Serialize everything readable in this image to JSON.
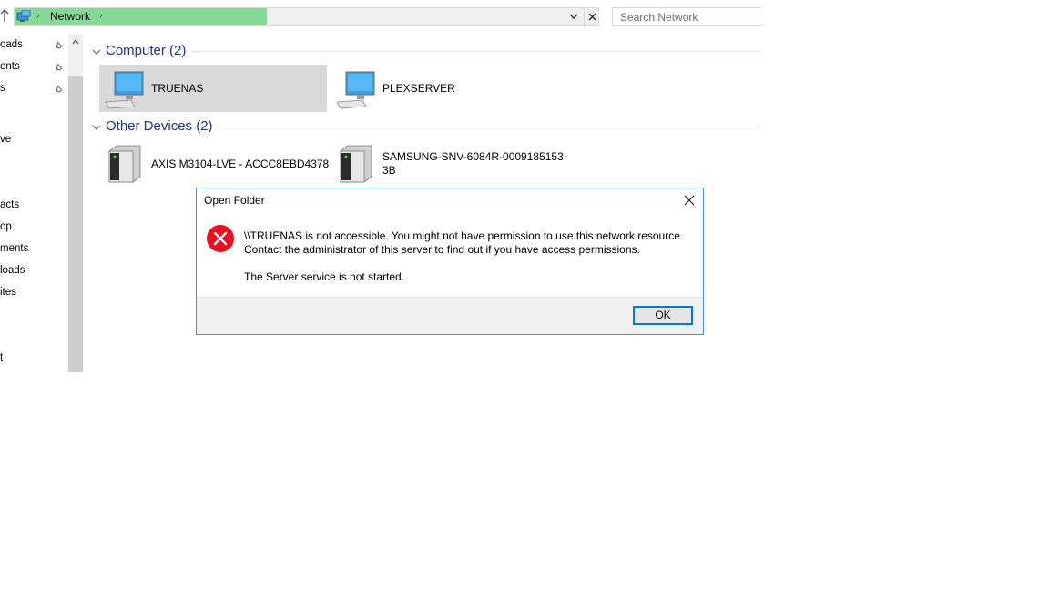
{
  "address": {
    "crumb": "Network",
    "sep": "›"
  },
  "search": {
    "placeholder": "Search Network"
  },
  "nav": {
    "items": [
      "oads",
      "ents",
      "s",
      "ve",
      "acts",
      "op",
      "ments",
      "loads",
      "ites",
      "t"
    ]
  },
  "groups": {
    "computer": {
      "title": "Computer (2)",
      "items": [
        "TRUENAS",
        "PLEXSERVER"
      ]
    },
    "other": {
      "title": "Other Devices (2)",
      "items": [
        {
          "line1": "AXIS M3104-LVE - ACCC8EBD4378",
          "line2": ""
        },
        {
          "line1": "SAMSUNG-SNV-6084R-0009185153",
          "line2": "3B"
        }
      ]
    }
  },
  "dialog": {
    "title": "Open Folder",
    "message_line1": "\\\\TRUENAS is not accessible. You might not have permission to use this network resource.",
    "message_line2": "Contact the administrator of this server to find out if you have access permissions.",
    "message_line3": "The Server service is not started.",
    "ok_label": "OK"
  },
  "colors": {
    "progress": "#86d996",
    "group_title": "#1e3287",
    "dialog_border": "#4a90d9",
    "error": "#e81123"
  }
}
